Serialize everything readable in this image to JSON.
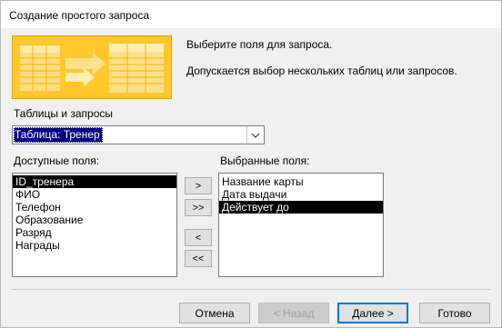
{
  "window": {
    "title": "Создание простого запроса"
  },
  "intro": {
    "line1": "Выберите поля для запроса.",
    "line2": "Допускается выбор нескольких таблиц или запросов."
  },
  "tables": {
    "label": "Таблицы и запросы",
    "selected_value": "Таблица: Тренер",
    "dropdown_icon": "chevron-down-icon"
  },
  "available_fields": {
    "label": "Доступные поля:",
    "items": [
      "ID_тренера",
      "ФИО",
      "Телефон",
      "Образование",
      "Разряд",
      "Награды"
    ],
    "selected_index": 0
  },
  "selected_fields": {
    "label": "Выбранные поля:",
    "items": [
      "Название карты",
      "Дата выдачи",
      "Действует до"
    ],
    "selected_index": 2
  },
  "move_buttons": {
    "add_one": ">",
    "add_all": ">>",
    "remove_one": "<",
    "remove_all": "<<"
  },
  "footer": {
    "cancel": "Отмена",
    "back": "< Назад",
    "next": "Далее >",
    "finish": "Готово"
  },
  "colors": {
    "illustration_bg": "#ffc72c",
    "selection_bg": "#000000",
    "combo_selection_bg": "#000080",
    "default_button_border": "#0078d7"
  }
}
